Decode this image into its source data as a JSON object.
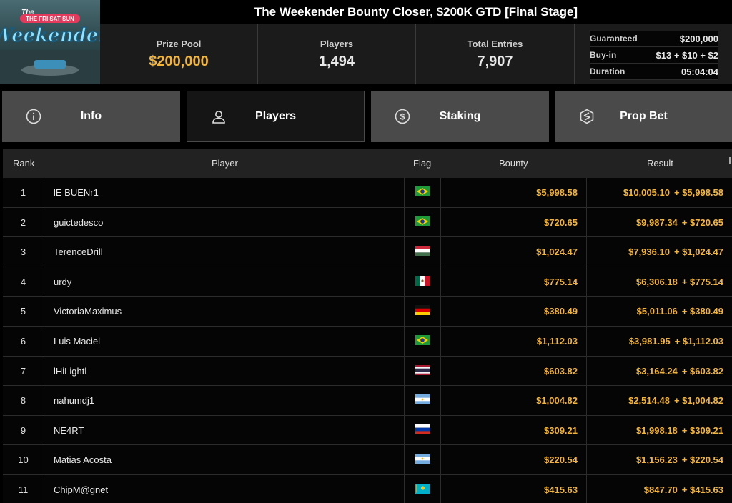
{
  "title": "The Weekender Bounty Closer, $200K GTD [Final Stage]",
  "logo": {
    "top_text": "THE FRI SAT SUN",
    "brand": "Weekender",
    "prefix": "The"
  },
  "stats": {
    "prize_pool": {
      "label": "Prize Pool",
      "value": "$200,000"
    },
    "players": {
      "label": "Players",
      "value": "1,494"
    },
    "entries": {
      "label": "Total Entries",
      "value": "7,907"
    }
  },
  "details": {
    "guaranteed": {
      "label": "Guaranteed",
      "value": "$200,000"
    },
    "buyin": {
      "label": "Buy-in",
      "value": "$13 + $10 + $2"
    },
    "duration": {
      "label": "Duration",
      "value": "05:04:04"
    }
  },
  "tabs": [
    {
      "label": "Info",
      "icon": "info-icon"
    },
    {
      "label": "Players",
      "icon": "user-icon"
    },
    {
      "label": "Staking",
      "icon": "dollar-coin-icon"
    },
    {
      "label": "Prop Bet",
      "icon": "prop-bet-icon"
    }
  ],
  "columns": {
    "rank": "Rank",
    "player": "Player",
    "flag": "Flag",
    "bounty": "Bounty",
    "result": "Result"
  },
  "colors": {
    "gold": "#f2b53a",
    "tab_bg": "#4a4a4a",
    "active_tab_bg": "#151515"
  },
  "players": [
    {
      "rank": "1",
      "name": "lE BUENr1",
      "flag": "brazil",
      "bounty": "$5,998.58",
      "result": "$10,005.10",
      "result_bounty": "+ $5,998.58"
    },
    {
      "rank": "2",
      "name": "guictedesco",
      "flag": "brazil",
      "bounty": "$720.65",
      "result": "$9,987.34",
      "result_bounty": "+ $720.65"
    },
    {
      "rank": "3",
      "name": "TerenceDrill",
      "flag": "hungary",
      "bounty": "$1,024.47",
      "result": "$7,936.10",
      "result_bounty": "+ $1,024.47"
    },
    {
      "rank": "4",
      "name": "urdy",
      "flag": "mexico",
      "bounty": "$775.14",
      "result": "$6,306.18",
      "result_bounty": "+ $775.14"
    },
    {
      "rank": "5",
      "name": "VictoriaMaximus",
      "flag": "germany",
      "bounty": "$380.49",
      "result": "$5,011.06",
      "result_bounty": "+ $380.49"
    },
    {
      "rank": "6",
      "name": "Luis Maciel",
      "flag": "brazil",
      "bounty": "$1,112.03",
      "result": "$3,981.95",
      "result_bounty": "+ $1,112.03"
    },
    {
      "rank": "7",
      "name": "lHiLightl",
      "flag": "thailand",
      "bounty": "$603.82",
      "result": "$3,164.24",
      "result_bounty": "+ $603.82"
    },
    {
      "rank": "8",
      "name": "nahumdj1",
      "flag": "argentina",
      "bounty": "$1,004.82",
      "result": "$2,514.48",
      "result_bounty": "+ $1,004.82"
    },
    {
      "rank": "9",
      "name": "NE4RT",
      "flag": "russia",
      "bounty": "$309.21",
      "result": "$1,998.18",
      "result_bounty": "+ $309.21"
    },
    {
      "rank": "10",
      "name": "Matias Acosta",
      "flag": "argentina",
      "bounty": "$220.54",
      "result": "$1,156.23",
      "result_bounty": "+ $220.54"
    },
    {
      "rank": "11",
      "name": "ChipM@gnet",
      "flag": "kazakhstan",
      "bounty": "$415.63",
      "result": "$847.70",
      "result_bounty": "+ $415.63"
    }
  ]
}
